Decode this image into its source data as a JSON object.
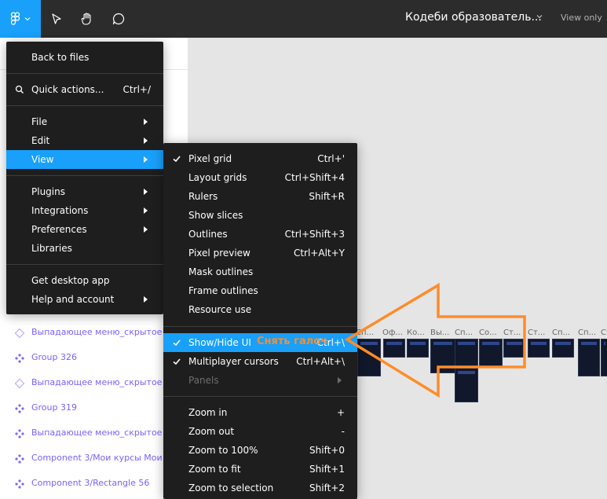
{
  "toolbar": {
    "menu_icon": "figma-logo-icon",
    "tools": [
      "move-cursor-icon",
      "hand-icon",
      "comment-icon"
    ],
    "file_title": "Кодеби образователь...",
    "view_only": "View only"
  },
  "main_menu": {
    "back": "Back to files",
    "quick_actions": "Quick actions...",
    "quick_actions_shortcut": "Ctrl+/",
    "file": "File",
    "edit": "Edit",
    "view": "View",
    "plugins": "Plugins",
    "integrations": "Integrations",
    "preferences": "Preferences",
    "libraries": "Libraries",
    "desktop": "Get desktop app",
    "help": "Help and account"
  },
  "view_menu": {
    "items": [
      {
        "label": "Pixel grid",
        "shortcut": "Ctrl+'",
        "checked": true
      },
      {
        "label": "Layout grids",
        "shortcut": "Ctrl+Shift+4",
        "checked": false
      },
      {
        "label": "Rulers",
        "shortcut": "Shift+R",
        "checked": false
      },
      {
        "label": "Show slices",
        "shortcut": "",
        "checked": false
      },
      {
        "label": "Outlines",
        "shortcut": "Ctrl+Shift+3",
        "checked": false
      },
      {
        "label": "Pixel preview",
        "shortcut": "Ctrl+Alt+Y",
        "checked": false
      },
      {
        "label": "Mask outlines",
        "shortcut": "",
        "checked": false
      },
      {
        "label": "Frame outlines",
        "shortcut": "",
        "checked": false
      },
      {
        "label": "Resource use",
        "shortcut": "",
        "checked": false
      }
    ],
    "show_hide_ui": {
      "label": "Show/Hide UI",
      "shortcut": "Ctrl+\\",
      "checked": true
    },
    "multiplayer": {
      "label": "Multiplayer cursors",
      "shortcut": "Ctrl+Alt+\\",
      "checked": true
    },
    "panels": "Panels",
    "zoom": [
      {
        "label": "Zoom in",
        "shortcut": "+"
      },
      {
        "label": "Zoom out",
        "shortcut": "-"
      },
      {
        "label": "Zoom to 100%",
        "shortcut": "Shift+0"
      },
      {
        "label": "Zoom to fit",
        "shortcut": "Shift+1"
      },
      {
        "label": "Zoom to selection",
        "shortcut": "Shift+2"
      }
    ]
  },
  "layers": [
    {
      "name": "Выпадающее меню_скрытое",
      "icon": "component-instance-icon"
    },
    {
      "name": "Group 326",
      "icon": "component-icon"
    },
    {
      "name": "Выпадающее меню_скрытое",
      "icon": "component-instance-icon"
    },
    {
      "name": "Group 319",
      "icon": "component-icon"
    },
    {
      "name": "Выпадающее меню_скрытое",
      "icon": "component-icon"
    },
    {
      "name": "Component 3/Мои курсы Мои",
      "icon": "component-icon"
    },
    {
      "name": "Component 3/Rectangle 56",
      "icon": "component-icon"
    }
  ],
  "canvas_labels": [
    "Сп...",
    "Оф...",
    "Ко...",
    "Вы...",
    "Сп...",
    "Со...",
    "Ст...",
    "Ст...",
    "Сп...",
    "Сп...",
    "Ст..."
  ],
  "annotation": {
    "text": "Снять галоч",
    "color": "#ff8c29"
  },
  "colors": {
    "accent": "#18a0fb",
    "menu_bg": "#1e1e1e",
    "toolbar_bg": "#2c2c2c",
    "layer_text": "#7b61ff"
  }
}
